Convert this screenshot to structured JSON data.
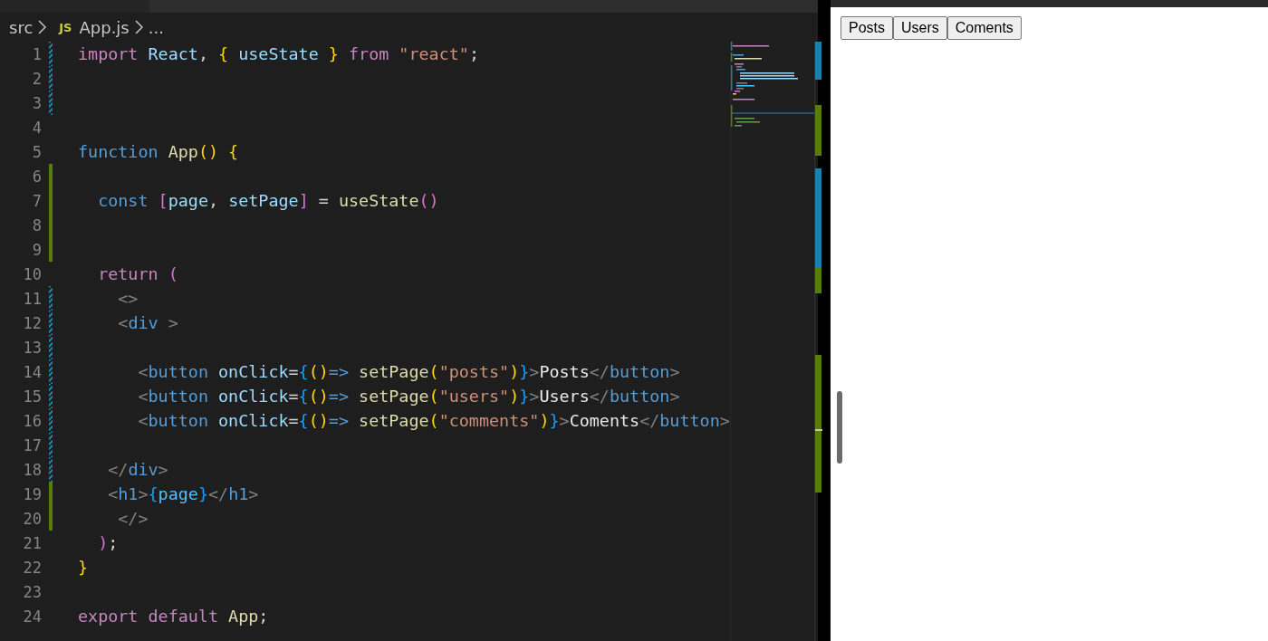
{
  "breadcrumb": {
    "folder": "src",
    "file_badge": "JS",
    "file": "App.js",
    "more": "..."
  },
  "editor": {
    "lines": [
      {
        "number": "1",
        "added": false,
        "modified": true,
        "tokens": [
          {
            "kind": "keyword",
            "text": "import"
          },
          {
            "kind": "variable",
            "text": " React"
          },
          {
            "kind": "punct",
            "text": ", "
          },
          {
            "kind": "bracket1",
            "text": "{"
          },
          {
            "kind": "variable",
            "text": " useState "
          },
          {
            "kind": "bracket1",
            "text": "}"
          },
          {
            "kind": "keyword",
            "text": " from "
          },
          {
            "kind": "string",
            "text": "\"react\""
          },
          {
            "kind": "punct",
            "text": ";"
          }
        ]
      },
      {
        "number": "2",
        "added": false,
        "modified": true
      },
      {
        "number": "3",
        "added": false,
        "modified": true
      },
      {
        "number": "4",
        "added": false,
        "modified": false
      },
      {
        "number": "5",
        "added": false,
        "modified": false,
        "tokens": [
          {
            "kind": "storage",
            "text": "function"
          },
          {
            "kind": "function",
            "text": " App"
          },
          {
            "kind": "bracket1",
            "text": "()"
          },
          {
            "kind": "bracket1",
            "text": " {"
          }
        ]
      },
      {
        "number": "6",
        "added": true,
        "modified": false
      },
      {
        "number": "7",
        "added": true,
        "modified": false,
        "tokens": [
          {
            "kind": "storage",
            "text": "  const"
          },
          {
            "kind": "bracket2",
            "text": " ["
          },
          {
            "kind": "variable",
            "text": "page"
          },
          {
            "kind": "punct",
            "text": ", "
          },
          {
            "kind": "variable",
            "text": "setPage"
          },
          {
            "kind": "bracket2",
            "text": "]"
          },
          {
            "kind": "punct",
            "text": " = "
          },
          {
            "kind": "function",
            "text": "useState"
          },
          {
            "kind": "bracket2",
            "text": "()"
          }
        ]
      },
      {
        "number": "8",
        "added": true,
        "modified": false
      },
      {
        "number": "9",
        "added": true,
        "modified": false
      },
      {
        "number": "10",
        "added": false,
        "modified": false,
        "tokens": [
          {
            "kind": "keyword",
            "text": "  return"
          },
          {
            "kind": "bracket2",
            "text": " ("
          }
        ]
      },
      {
        "number": "11",
        "added": false,
        "modified": true,
        "tokens": [
          {
            "kind": "tagpunct",
            "text": "    <>"
          }
        ]
      },
      {
        "number": "12",
        "added": false,
        "modified": true,
        "tokens": [
          {
            "kind": "tagpunct",
            "text": "    <"
          },
          {
            "kind": "tag",
            "text": "div"
          },
          {
            "kind": "tagpunct",
            "text": " >"
          }
        ]
      },
      {
        "number": "13",
        "added": false,
        "modified": true
      },
      {
        "number": "14",
        "added": false,
        "modified": true,
        "tokens": [
          {
            "kind": "tagpunct",
            "text": "      <"
          },
          {
            "kind": "tag",
            "text": "button"
          },
          {
            "kind": "variable",
            "text": " onClick"
          },
          {
            "kind": "punct",
            "text": "="
          },
          {
            "kind": "bracket3",
            "text": "{"
          },
          {
            "kind": "bracket1",
            "text": "()"
          },
          {
            "kind": "storage",
            "text": "=>"
          },
          {
            "kind": "function",
            "text": " setPage"
          },
          {
            "kind": "bracket1",
            "text": "("
          },
          {
            "kind": "string",
            "text": "\"posts\""
          },
          {
            "kind": "bracket1",
            "text": ")"
          },
          {
            "kind": "bracket3",
            "text": "}"
          },
          {
            "kind": "tagpunct",
            "text": ">"
          },
          {
            "kind": "text",
            "text": "Posts"
          },
          {
            "kind": "tagpunct",
            "text": "</"
          },
          {
            "kind": "tag",
            "text": "button"
          },
          {
            "kind": "tagpunct",
            "text": ">"
          }
        ]
      },
      {
        "number": "15",
        "added": false,
        "modified": true,
        "tokens": [
          {
            "kind": "tagpunct",
            "text": "      <"
          },
          {
            "kind": "tag",
            "text": "button"
          },
          {
            "kind": "variable",
            "text": " onClick"
          },
          {
            "kind": "punct",
            "text": "="
          },
          {
            "kind": "bracket3",
            "text": "{"
          },
          {
            "kind": "bracket1",
            "text": "()"
          },
          {
            "kind": "storage",
            "text": "=>"
          },
          {
            "kind": "function",
            "text": " setPage"
          },
          {
            "kind": "bracket1",
            "text": "("
          },
          {
            "kind": "string",
            "text": "\"users\""
          },
          {
            "kind": "bracket1",
            "text": ")"
          },
          {
            "kind": "bracket3",
            "text": "}"
          },
          {
            "kind": "tagpunct",
            "text": ">"
          },
          {
            "kind": "text",
            "text": "Users"
          },
          {
            "kind": "tagpunct",
            "text": "</"
          },
          {
            "kind": "tag",
            "text": "button"
          },
          {
            "kind": "tagpunct",
            "text": ">"
          }
        ]
      },
      {
        "number": "16",
        "added": false,
        "modified": true,
        "tokens": [
          {
            "kind": "tagpunct",
            "text": "      <"
          },
          {
            "kind": "tag",
            "text": "button"
          },
          {
            "kind": "variable",
            "text": " onClick"
          },
          {
            "kind": "punct",
            "text": "="
          },
          {
            "kind": "bracket3",
            "text": "{"
          },
          {
            "kind": "bracket1",
            "text": "()"
          },
          {
            "kind": "storage",
            "text": "=>"
          },
          {
            "kind": "function",
            "text": " setPage"
          },
          {
            "kind": "bracket1",
            "text": "("
          },
          {
            "kind": "string",
            "text": "\"comments\""
          },
          {
            "kind": "bracket1",
            "text": ")"
          },
          {
            "kind": "bracket3",
            "text": "}"
          },
          {
            "kind": "tagpunct",
            "text": ">"
          },
          {
            "kind": "text",
            "text": "Coments"
          },
          {
            "kind": "tagpunct",
            "text": "</"
          },
          {
            "kind": "tag",
            "text": "button"
          },
          {
            "kind": "tagpunct",
            "text": ">"
          }
        ]
      },
      {
        "number": "17",
        "added": false,
        "modified": true
      },
      {
        "number": "18",
        "added": false,
        "modified": true,
        "tokens": [
          {
            "kind": "tagpunct",
            "text": "   </"
          },
          {
            "kind": "tag",
            "text": "div"
          },
          {
            "kind": "tagpunct",
            "text": ">"
          }
        ]
      },
      {
        "number": "19",
        "added": true,
        "modified": false,
        "tokens": [
          {
            "kind": "tagpunct",
            "text": "   <"
          },
          {
            "kind": "tag",
            "text": "h1"
          },
          {
            "kind": "tagpunct",
            "text": ">"
          },
          {
            "kind": "bracket3",
            "text": "{"
          },
          {
            "kind": "constant",
            "text": "page"
          },
          {
            "kind": "bracket3",
            "text": "}"
          },
          {
            "kind": "tagpunct",
            "text": "</"
          },
          {
            "kind": "tag",
            "text": "h1"
          },
          {
            "kind": "tagpunct",
            "text": ">"
          }
        ]
      },
      {
        "number": "20",
        "added": true,
        "modified": false,
        "tokens": [
          {
            "kind": "tagpunct",
            "text": "    </>"
          }
        ]
      },
      {
        "number": "21",
        "added": false,
        "modified": false,
        "tokens": [
          {
            "kind": "bracket2",
            "text": "  )"
          },
          {
            "kind": "punct",
            "text": ";"
          }
        ]
      },
      {
        "number": "22",
        "added": false,
        "modified": false,
        "tokens": [
          {
            "kind": "bracket1",
            "text": "}"
          }
        ]
      },
      {
        "number": "23",
        "added": false,
        "modified": false
      },
      {
        "number": "24",
        "added": false,
        "modified": false,
        "tokens": [
          {
            "kind": "keyword",
            "text": "export"
          },
          {
            "kind": "keyword",
            "text": " default"
          },
          {
            "kind": "function",
            "text": " App"
          },
          {
            "kind": "punct",
            "text": ";"
          }
        ]
      }
    ]
  },
  "preview": {
    "buttons": [
      "Posts",
      "Users",
      "Coments"
    ]
  }
}
